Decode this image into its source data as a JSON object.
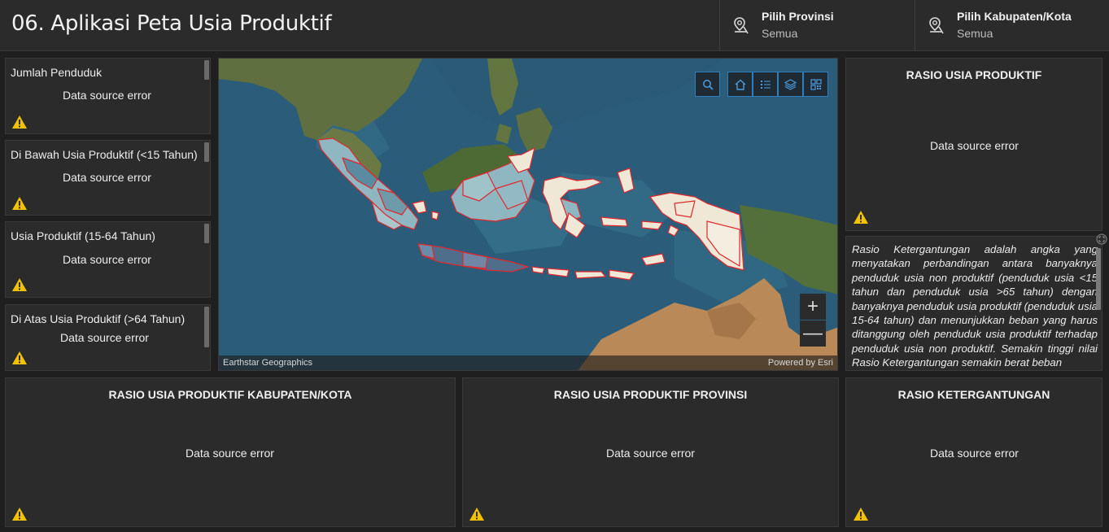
{
  "header": {
    "title": "06. Aplikasi Peta Usia Produktif",
    "province": {
      "label": "Pilih Provinsi",
      "value": "Semua"
    },
    "regency": {
      "label": "Pilih Kabupaten/Kota",
      "value": "Semua"
    }
  },
  "stats": [
    {
      "title": "Jumlah Penduduk",
      "status": "Data source error"
    },
    {
      "title": "Di Bawah Usia Produktif (<15 Tahun)",
      "status": "Data source error"
    },
    {
      "title": "Usia Produktif (15-64 Tahun)",
      "status": "Data source error"
    },
    {
      "title": "Di Atas Usia Produktif (>64 Tahun)",
      "status": "Data source error"
    }
  ],
  "map": {
    "attribution_left": "Earthstar Geographics",
    "attribution_right": "Powered by Esri",
    "zoom_in": "+",
    "zoom_out": "—",
    "tools": [
      "search-icon",
      "home-icon",
      "legend-list-icon",
      "layers-icon",
      "qr-code-icon"
    ]
  },
  "rasio_usia_produktif": {
    "title": "RASIO USIA PRODUKTIF",
    "status": "Data source error"
  },
  "description": "Rasio Ketergantungan adalah angka yang menyatakan perbandingan antara banyaknya penduduk usia non produktif (penduduk usia <15 tahun dan penduduk usia >65 tahun) dengan banyaknya penduduk usia produktif (penduduk usia 15-64 tahun) dan menunjukkan beban yang harus ditanggung oleh penduduk usia produktif terhadap penduduk usia non produktif. Semakin tinggi nilai Rasio Ketergantungan semakin berat beban",
  "bottom_charts": [
    {
      "title": "RASIO USIA PRODUKTIF KABUPATEN/KOTA",
      "status": "Data source error"
    },
    {
      "title": "RASIO USIA PRODUKTIF PROVINSI",
      "status": "Data source error"
    },
    {
      "title": "RASIO KETERGANTUNGAN",
      "status": "Data source error"
    }
  ],
  "colors": {
    "background": "#1f1f1f",
    "panel": "#2b2b2b",
    "warning": "#f2c200",
    "map_accent": "#2d7fc0",
    "region_outline": "#e0282e"
  }
}
